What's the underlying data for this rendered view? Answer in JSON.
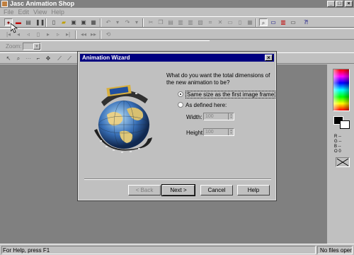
{
  "app": {
    "title": "Jasc Animation Shop"
  },
  "window_controls": {
    "minimize": "_",
    "maximize": "□",
    "close": "×"
  },
  "menu": [
    {
      "label": "File"
    },
    {
      "label": "Edit"
    },
    {
      "label": "View"
    },
    {
      "label": "Help"
    }
  ],
  "toolbar_zoom": {
    "label": "Zoom:",
    "value": ""
  },
  "dialog": {
    "title": "Animation Wizard",
    "close": "×",
    "question": "What do you want the total dimensions of the new animation to be?",
    "option_same": "Same size as the first image frame",
    "option_defined": "As defined here:",
    "width_label": "Width:",
    "height_label": "Height:",
    "width_value": "100",
    "height_value": "100",
    "back_button": "< Back",
    "next_button": "Next >",
    "cancel_button": "Cancel",
    "help_button": "Help"
  },
  "palette": {
    "rgb": [
      "R --",
      "G --",
      "B --",
      "O 0"
    ]
  },
  "status": {
    "left": "For Help, press F1",
    "right": "No files open"
  },
  "colors": {
    "dialog_title_bg": "#000080",
    "workspace": "#808080",
    "face": "#c0c0c0"
  }
}
